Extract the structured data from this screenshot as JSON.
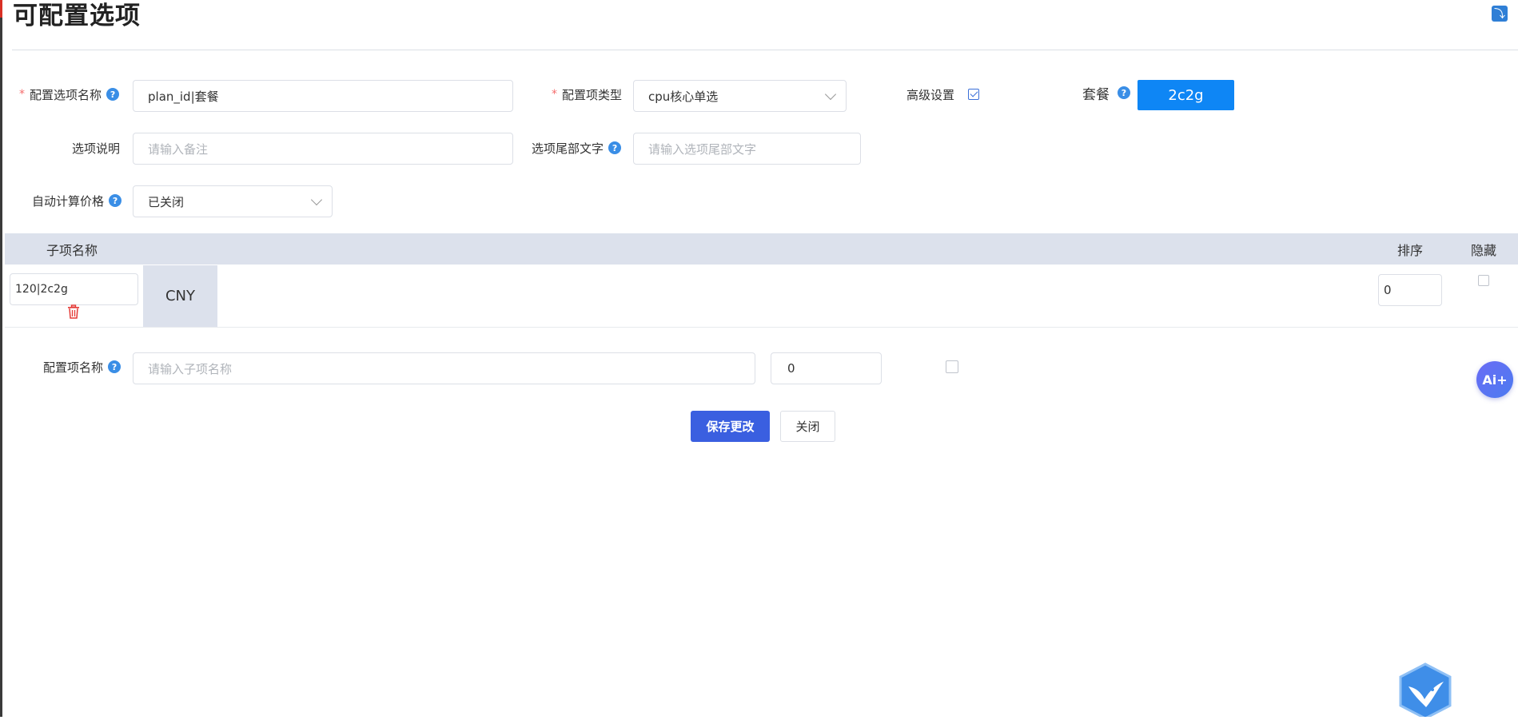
{
  "page": {
    "title": "可配置选项"
  },
  "form": {
    "option_name": {
      "label": "配置选项名称",
      "required": true,
      "value": "plan_id|套餐"
    },
    "option_type": {
      "label": "配置项类型",
      "required": true,
      "value": "cpu核心单选"
    },
    "advanced": {
      "label": "高级设置",
      "checked": true
    },
    "plan": {
      "label": "套餐",
      "button_label": "2c2g"
    },
    "description": {
      "label": "选项说明",
      "placeholder": "请输入备注"
    },
    "suffix": {
      "label": "选项尾部文字",
      "placeholder": "请输入选项尾部文字"
    },
    "auto_price": {
      "label": "自动计算价格",
      "value": "已关闭"
    }
  },
  "table": {
    "headers": {
      "name": "子项名称",
      "sort": "排序",
      "hide": "隐藏"
    },
    "rows": [
      {
        "name": "120|2c2g",
        "currency": "CNY",
        "sort": "0",
        "hidden": false
      }
    ]
  },
  "new_item": {
    "label": "配置项名称",
    "placeholder": "请输入子项名称",
    "sort_value": "0",
    "hidden": false
  },
  "actions": {
    "save": "保存更改",
    "close": "关闭"
  },
  "floating": {
    "ai_label": "Ai+"
  },
  "colors": {
    "primary": "#3a5fe0",
    "plan_button": "#0e86f5",
    "header_bg": "#dce1ec",
    "help_icon": "#3a8ee6",
    "required": "#f56c6c"
  },
  "icons": [
    "help-icon",
    "chevron-down-icon",
    "checkbox-icon",
    "trash-icon",
    "ai-assistant-icon",
    "bird-logo-icon",
    "refresh-corner-icon"
  ]
}
